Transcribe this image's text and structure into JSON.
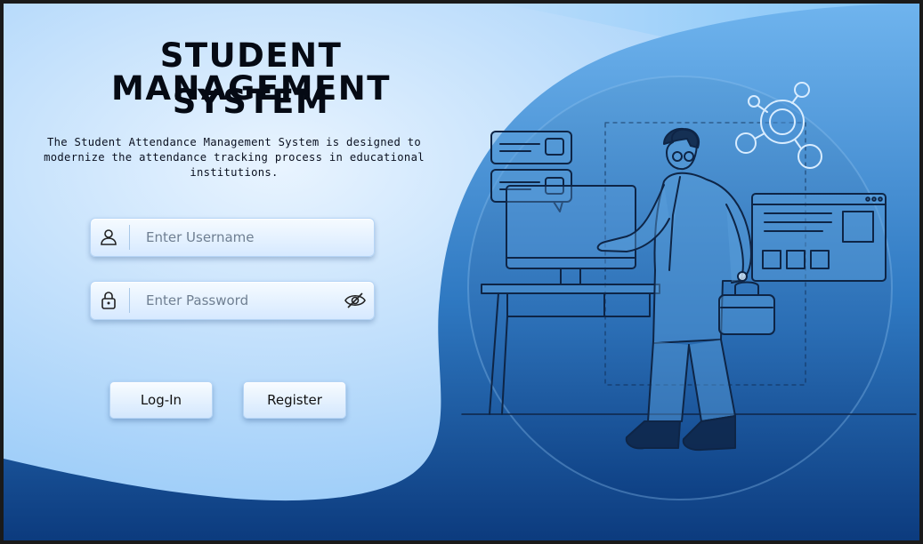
{
  "header": {
    "title_line1": "STUDENT MANAGEMENT",
    "title_line2": "SYSTEM",
    "description": "The Student Attendance Management System is designed to modernize the attendance tracking process in educational institutions."
  },
  "form": {
    "username": {
      "placeholder": "Enter Username",
      "value": "",
      "icon": "user-icon"
    },
    "password": {
      "placeholder": "Enter Password",
      "value": "",
      "icon": "lock-icon",
      "toggle_icon": "eye-off-icon"
    },
    "login_label": "Log-In",
    "register_label": "Register"
  },
  "illustration": {
    "subject": "person presenting at a computer desk holding a briefcase",
    "icons": [
      "chat-bubble-icon",
      "monitor-icon",
      "browser-window-icon",
      "network-nodes-icon",
      "briefcase-icon"
    ]
  },
  "colors": {
    "accent_dark": "#0b3f86",
    "accent_mid": "#2a73c0",
    "accent_light": "#8ec8ff",
    "text": "#050a14"
  }
}
